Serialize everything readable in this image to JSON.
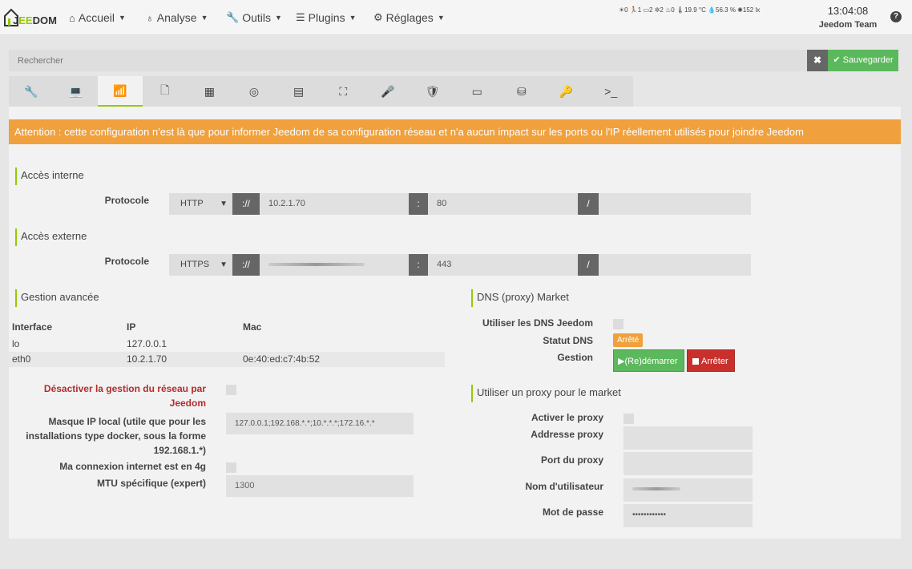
{
  "nav": {
    "brand_prefix": "J",
    "brand_highlight": "EE",
    "brand_suffix": "DOM",
    "menus": [
      {
        "label": "Accueil",
        "icon": "home-icon"
      },
      {
        "label": "Analyse",
        "icon": "stethoscope-icon"
      },
      {
        "label": "Outils",
        "icon": "wrench-icon"
      },
      {
        "label": "Plugins",
        "icon": "tasks-icon"
      },
      {
        "label": "Réglages",
        "icon": "cog-icon"
      }
    ],
    "sensors": "☀0  🏃1  ▭2  ✲2  ♨0  🌡19.9 °C  💧56.3 %  ✺152 lx",
    "time": "13:04:08",
    "user": "Jeedom Team"
  },
  "search": {
    "placeholder": "Rechercher"
  },
  "actions": {
    "clear": "✖",
    "save": "Sauvegarder"
  },
  "tabs": [
    {
      "icon": "wrench-icon",
      "glyph": "🔧"
    },
    {
      "icon": "laptop-icon",
      "glyph": "💻"
    },
    {
      "icon": "rss-icon",
      "glyph": "📶"
    },
    {
      "icon": "file-icon",
      "glyph": "🗋"
    },
    {
      "icon": "table-icon",
      "glyph": "▦"
    },
    {
      "icon": "target-icon",
      "glyph": "◎"
    },
    {
      "icon": "database-icon",
      "glyph": "▤"
    },
    {
      "icon": "sitemap-icon",
      "glyph": "⛶"
    },
    {
      "icon": "microphone-icon",
      "glyph": "🎤"
    },
    {
      "icon": "shield-icon",
      "glyph": "🛡"
    },
    {
      "icon": "credit-card-icon",
      "glyph": "▭"
    },
    {
      "icon": "hdd-icon",
      "glyph": "⛁"
    },
    {
      "icon": "key-icon",
      "glyph": "🔑"
    },
    {
      "icon": "terminal-icon",
      "glyph": ">_"
    }
  ],
  "alert": "Attention : cette configuration n'est là que pour informer Jeedom de sa configuration réseau et n'a aucun impact sur les ports ou l'IP réellement utilisés pour joindre Jeedom",
  "internal": {
    "legend": "Accès interne",
    "label": "Protocole",
    "protocol": "HTTP",
    "sep1": "://",
    "ip": "10.2.1.70",
    "sep2": ":",
    "port": "80",
    "sep3": "/",
    "path": ""
  },
  "external": {
    "legend": "Accès externe",
    "label": "Protocole",
    "protocol": "HTTPS",
    "sep1": "://",
    "sep2": ":",
    "port": "443",
    "sep3": "/",
    "path": ""
  },
  "advanced": {
    "legend": "Gestion avancée",
    "headers": [
      "Interface",
      "IP",
      "Mac"
    ],
    "rows": [
      [
        "lo",
        "127.0.0.1",
        ""
      ],
      [
        "eth0",
        "10.2.1.70",
        "0e:40:ed:c7:4b:52"
      ]
    ],
    "disable_label_1": "Désactiver la gestion du réseau par",
    "disable_label_2": "Jeedom",
    "mask_label_1": "Masque IP local (utile que pour les",
    "mask_label_2": "installations type docker, sous la forme",
    "mask_label_3": "192.168.1.*)",
    "mask_value": "127.0.0.1;192.168.*.*;10.*.*.*;172.16.*.*",
    "4g_label": "Ma connexion internet est en 4g",
    "mtu_label": "MTU spécifique (expert)",
    "mtu_placeholder": "1300"
  },
  "dns": {
    "legend": "DNS (proxy) Market",
    "use_label": "Utiliser les DNS Jeedom",
    "status_label": "Statut DNS",
    "status_value": "Arrêté",
    "manage_label": "Gestion",
    "restart_label": "(Re)démarrer",
    "stop_label": "Arrêter"
  },
  "proxy": {
    "legend": "Utiliser un proxy pour le market",
    "enable_label": "Activer le proxy",
    "address_label": "Addresse proxy",
    "port_label": "Port du proxy",
    "user_label": "Nom d'utilisateur",
    "password_label": "Mot de passe",
    "password_mask": "••••••••••••"
  },
  "colors": {
    "accent": "#94ca02",
    "warning": "#f0a03c",
    "success": "#5cb85c",
    "danger": "#c9302c"
  }
}
